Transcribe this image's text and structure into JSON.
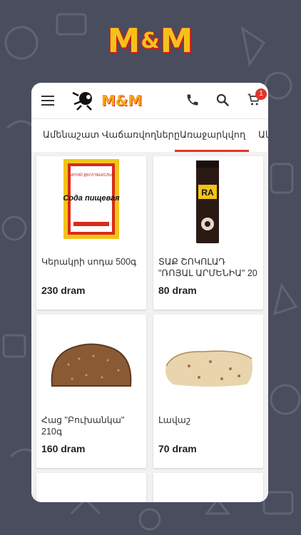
{
  "brand": {
    "left": "M",
    "amp": "&",
    "right": "M"
  },
  "appbar": {
    "logo_text": "M&M",
    "cart_count": "1"
  },
  "tabs": [
    "Ամենաշատ Վաճառվողները",
    "Առաջարկվող",
    "Ակ"
  ],
  "products": [
    {
      "name": "Կերակրի սոդա 500գ",
      "price": "230 dram"
    },
    {
      "name": "ՏԱՔ ՇՈԿՈԼԱԴ \"ՌՈՅԱԼ ԱՐՄԵՆԻԱ\" 20",
      "price": "80 dram"
    },
    {
      "name": "Հաց \"Բուխանկա\" 210գ",
      "price": "160 dram"
    },
    {
      "name": "Լավաշ",
      "price": "70 dram"
    }
  ],
  "images": {
    "soda_pack_text": "Сода пищевая",
    "soda_top_text": "НАТРИЙ ДВУУГЛЕКИСЛЫЙ",
    "choco_brand": "RA"
  },
  "colors": {
    "accent": "#e0352b",
    "logo": "#f3a81a",
    "background": "#4a4d5e"
  }
}
